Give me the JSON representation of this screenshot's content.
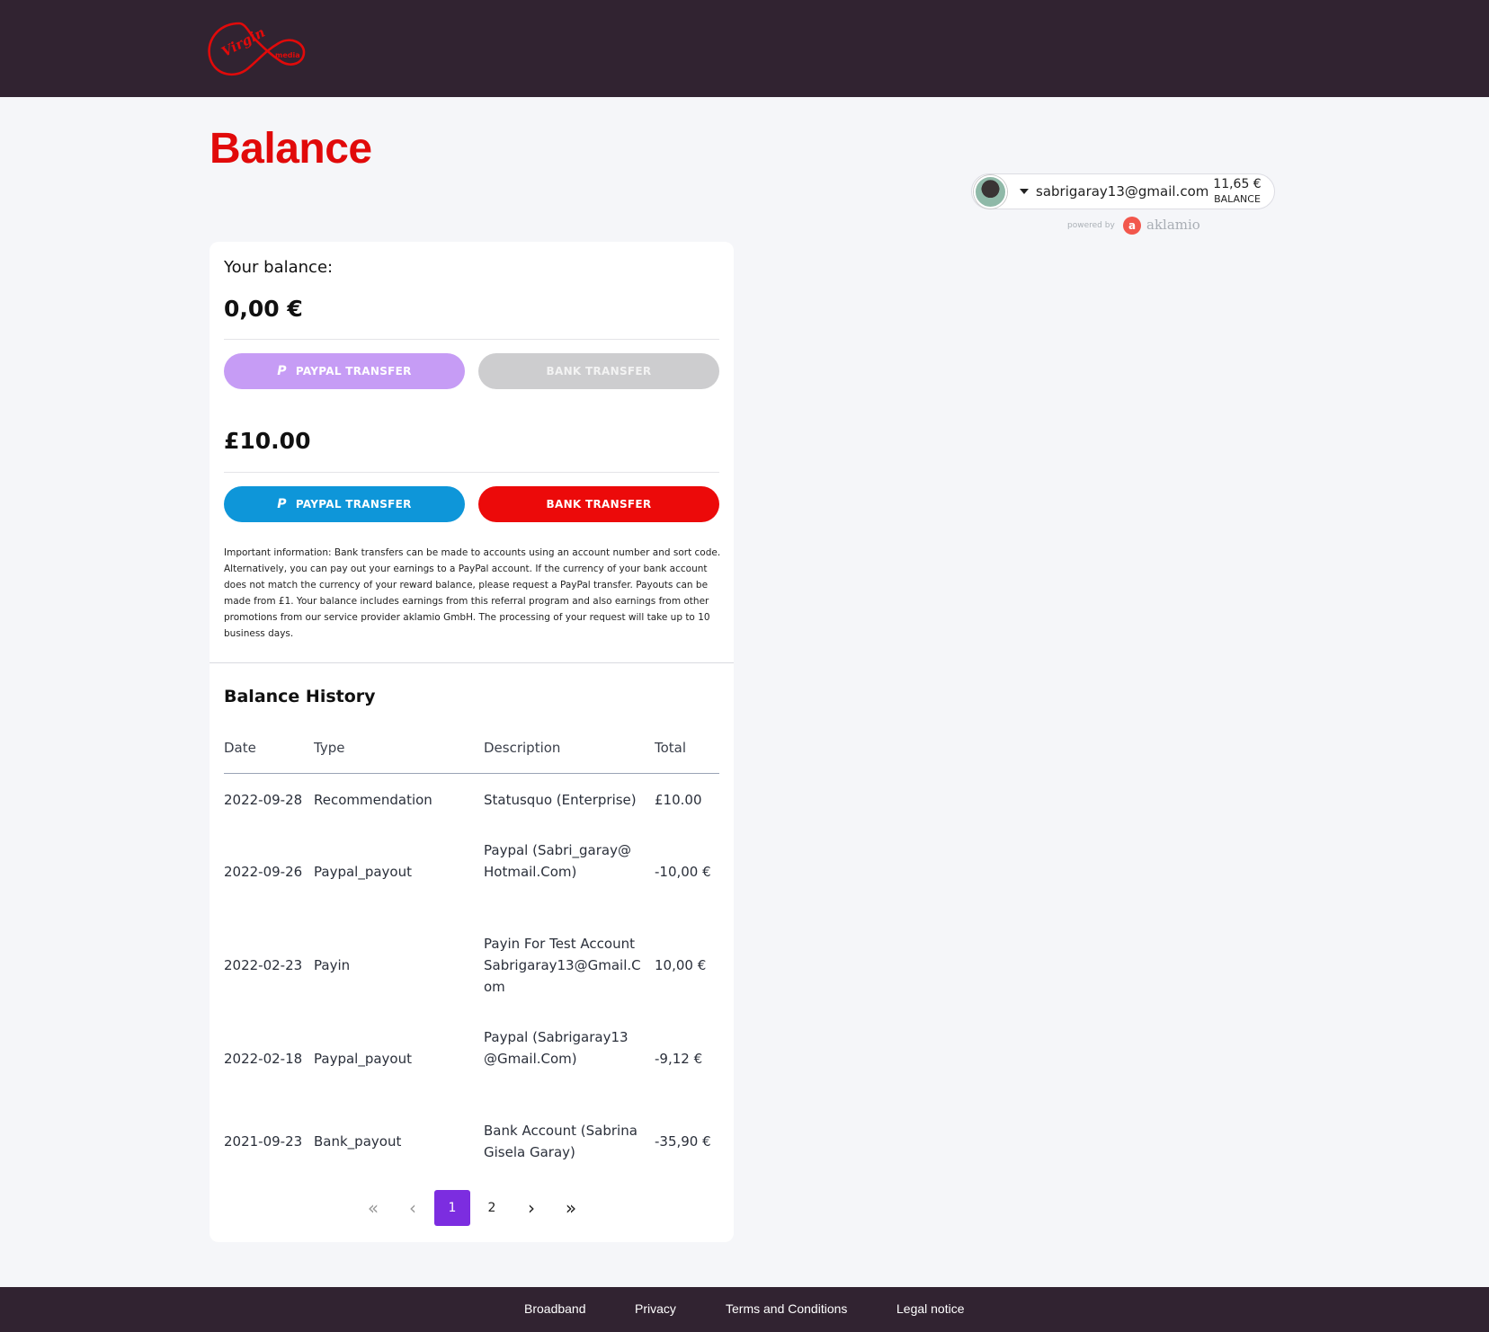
{
  "header": {
    "logo_alt": "Virgin media"
  },
  "page": {
    "title": "Balance"
  },
  "account": {
    "email": "sabrigaray13@gmail.com",
    "balance_value": "11,65 €",
    "balance_label": "BALANCE",
    "powered_by": "powered by",
    "provider": "aklamio"
  },
  "balance": {
    "label": "Your balance:",
    "eur_amount": "0,00 €",
    "gbp_amount": "£10.00",
    "paypal_transfer": "PAYPAL TRANSFER",
    "bank_transfer": "BANK TRANSFER",
    "info": "Important information: Bank transfers can be made to accounts using an account number and sort code. Alternatively, you can pay out your earnings to a PayPal account. If the currency of your bank account does not match the currency of your reward balance, please request a PayPal transfer. Payouts can be made from £1. Your balance includes earnings from this referral program and also earnings from other promotions from our service provider aklamio GmbH. The processing of your request will take up to 10 business days."
  },
  "history": {
    "title": "Balance History",
    "columns": [
      "Date",
      "Type",
      "Description",
      "Total"
    ],
    "rows": [
      {
        "date": "2022-09-28",
        "type": "Recommendation",
        "description": "Statusquo (Enterprise)",
        "total": "£10.00"
      },
      {
        "date": "2022-09-26",
        "type": "Paypal_payout",
        "description": "Paypal (Sabri_garay@Hotmail.Com)",
        "total": "-10,00 €"
      },
      {
        "date": "2022-02-23",
        "type": "Payin",
        "description": "Payin For Test Account Sabrigaray13@Gmail.Com",
        "total": "10,00 €"
      },
      {
        "date": "2022-02-18",
        "type": "Paypal_payout",
        "description": "Paypal (Sabrigaray13@Gmail.Com)",
        "total": "-9,12 €"
      },
      {
        "date": "2021-09-23",
        "type": "Bank_payout",
        "description": "Bank Account (Sabrina Gisela Garay)",
        "total": "-35,90 €"
      }
    ]
  },
  "pagination": {
    "first": "«",
    "prev": "‹",
    "pages": [
      "1",
      "2"
    ],
    "next": "›",
    "last": "»",
    "current": "1"
  },
  "footer": {
    "links": [
      "Broadband",
      "Privacy",
      "Terms and Conditions",
      "Legal notice"
    ]
  },
  "icons": {
    "logo": "virgin-media-logo",
    "paypal": "paypal-icon",
    "caret": "caret-down-icon"
  },
  "colors": {
    "brand_red": "#e10a0a",
    "header_bg": "#312331",
    "paypal_blue": "#0e96d9",
    "paypal_disabled": "#c69cf5",
    "bank_red": "#ec0a0a",
    "bank_disabled": "#cdcdcf",
    "pager_active": "#7c2de0"
  }
}
